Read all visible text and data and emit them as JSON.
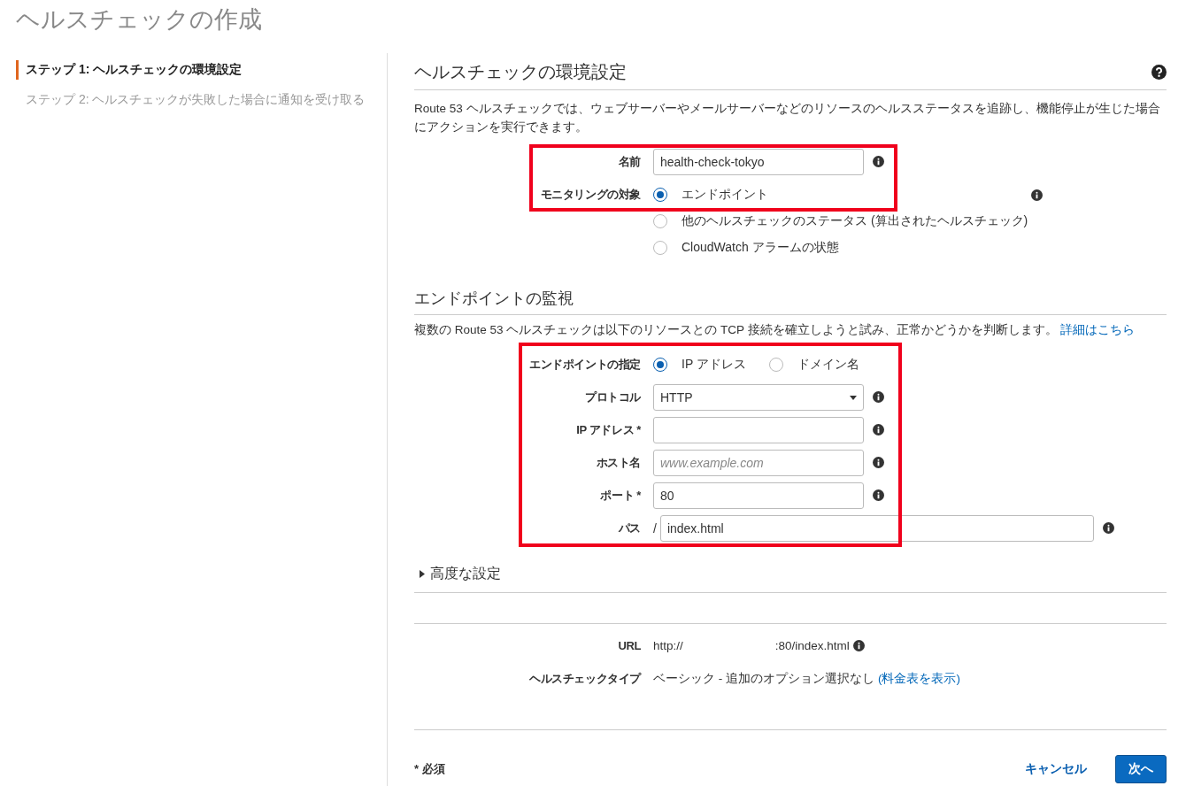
{
  "page_title": "ヘルスチェックの作成",
  "steps": [
    {
      "label": "ステップ 1: ヘルスチェックの環境設定",
      "selected": true
    },
    {
      "label": "ステップ 2: ヘルスチェックが失敗した場合に通知を受け取る",
      "selected": false
    }
  ],
  "section_config": {
    "heading": "ヘルスチェックの環境設定",
    "description": "Route 53 ヘルスチェックでは、ウェブサーバーやメールサーバーなどのリソースのヘルスステータスを追跡し、機能停止が生じた場合にアクションを実行できます。",
    "rows": [
      {
        "kind": "text",
        "label": "名前",
        "value": "health-check-tokyo"
      },
      {
        "kind": "radio_vertical",
        "label": "モニタリングの対象",
        "options": [
          {
            "label": "エンドポイント",
            "selected": true
          },
          {
            "label": "他のヘルスチェックのステータス (算出されたヘルスチェック)",
            "selected": false
          },
          {
            "label": "CloudWatch アラームの状態",
            "selected": false
          }
        ]
      }
    ]
  },
  "section_endpoint": {
    "heading": "エンドポイントの監視",
    "description": "複数の Route 53 ヘルスチェックは以下のリソースとの TCP 接続を確立しようと試み、正常かどうかを判断します。",
    "link": "詳細はこちら",
    "rows": [
      {
        "kind": "radio_inline",
        "label": "エンドポイントの指定",
        "options": [
          {
            "label": "IP アドレス",
            "selected": true
          },
          {
            "label": "ドメイン名",
            "selected": false
          }
        ]
      },
      {
        "kind": "select",
        "label": "プロトコル",
        "value": "HTTP"
      },
      {
        "kind": "text",
        "label": "IP アドレス *"
      },
      {
        "kind": "text",
        "label": "ホスト名",
        "placeholder": "www.example.com"
      },
      {
        "kind": "text",
        "label": "ポート *",
        "value": "80"
      },
      {
        "kind": "path",
        "label": "パス",
        "prefix": "/",
        "value": "index.html"
      }
    ]
  },
  "advanced": {
    "label": "高度な設定",
    "expanded": false
  },
  "summary": {
    "url_label": "URL",
    "url_start": "http://",
    "url_end": ":80/index.html",
    "type_label": "ヘルスチェックタイプ",
    "type_value": "ベーシック - 追加のオプション選択なし",
    "type_link": "(料金表を表示)"
  },
  "footer": {
    "required_note": "* 必須",
    "cancel": "キャンセル",
    "next": "次へ"
  }
}
